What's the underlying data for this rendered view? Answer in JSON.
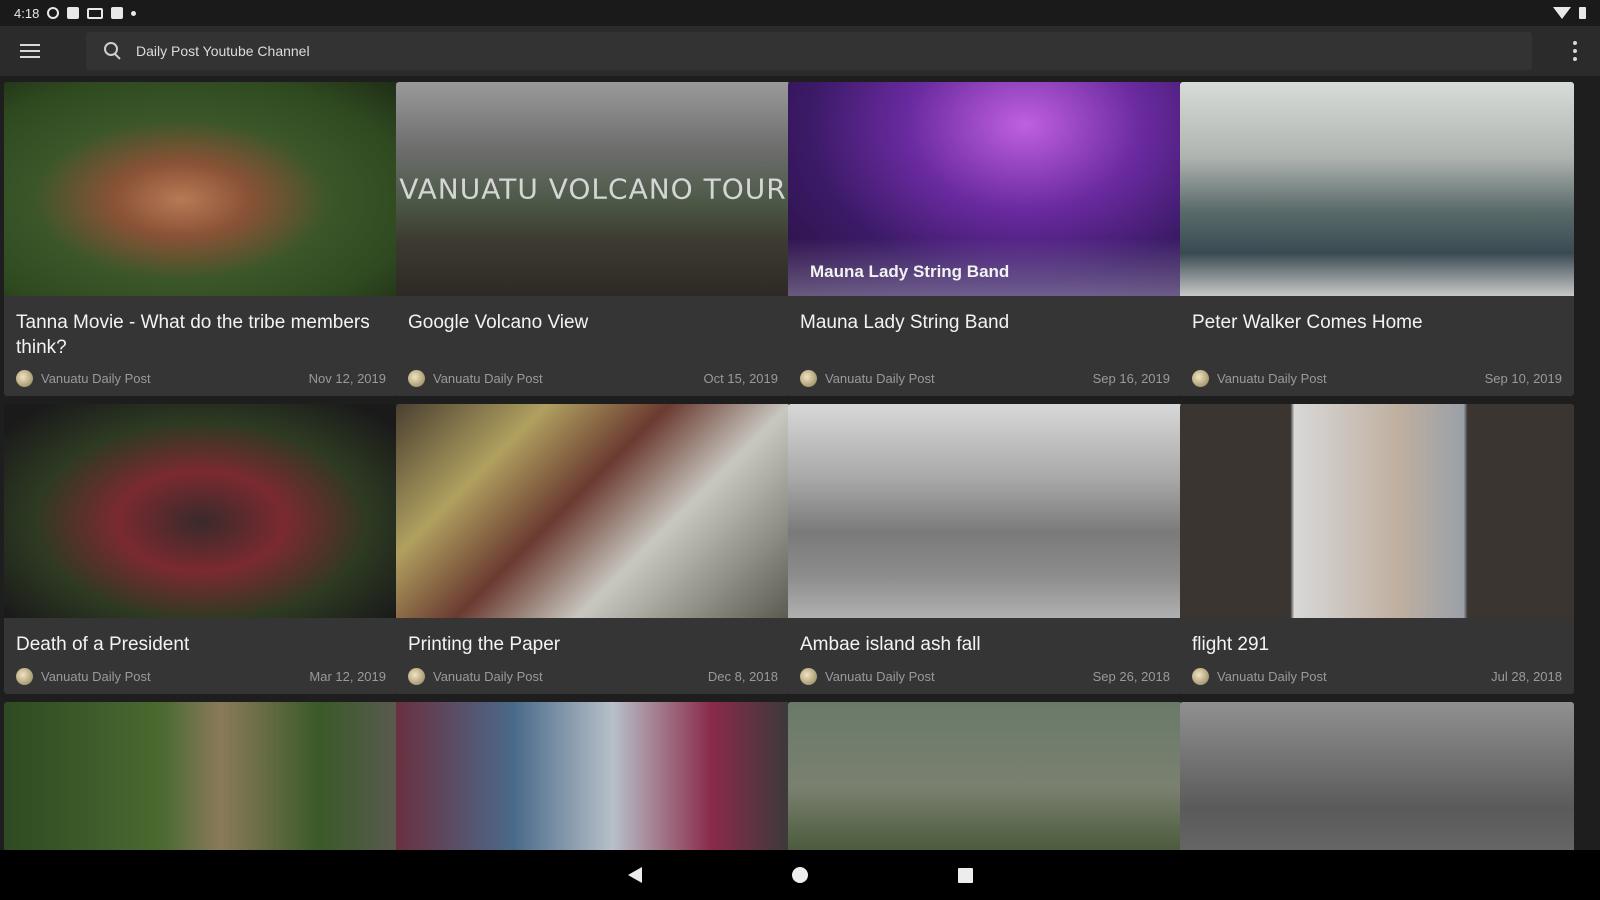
{
  "status": {
    "time": "4:18"
  },
  "search": {
    "text": "Daily Post Youtube Channel"
  },
  "videos": [
    {
      "title": "Tanna Movie - What do the tribe members think?",
      "channel": "Vanuatu Daily Post",
      "date": "Nov 12, 2019"
    },
    {
      "title": "Google Volcano View",
      "channel": "Vanuatu Daily Post",
      "date": "Oct 15, 2019",
      "thumb_text": "VANUATU VOLCANO TOUR"
    },
    {
      "title": "Mauna Lady String Band",
      "channel": "Vanuatu Daily Post",
      "date": "Sep 16, 2019",
      "thumb_text": "Mauna Lady String Band"
    },
    {
      "title": "Peter Walker Comes Home",
      "channel": "Vanuatu Daily Post",
      "date": "Sep 10, 2019"
    },
    {
      "title": "Death of a President",
      "channel": "Vanuatu Daily Post",
      "date": "Mar 12, 2019"
    },
    {
      "title": "Printing the Paper",
      "channel": "Vanuatu Daily Post",
      "date": "Dec 8, 2018"
    },
    {
      "title": "Ambae island ash fall",
      "channel": "Vanuatu Daily Post",
      "date": "Sep 26, 2018"
    },
    {
      "title": "flight 291",
      "channel": "Vanuatu Daily Post",
      "date": "Jul 28, 2018"
    }
  ],
  "colors": {
    "background": "#1e1e1e",
    "card": "#353535",
    "appbar": "#2b2b2b"
  }
}
